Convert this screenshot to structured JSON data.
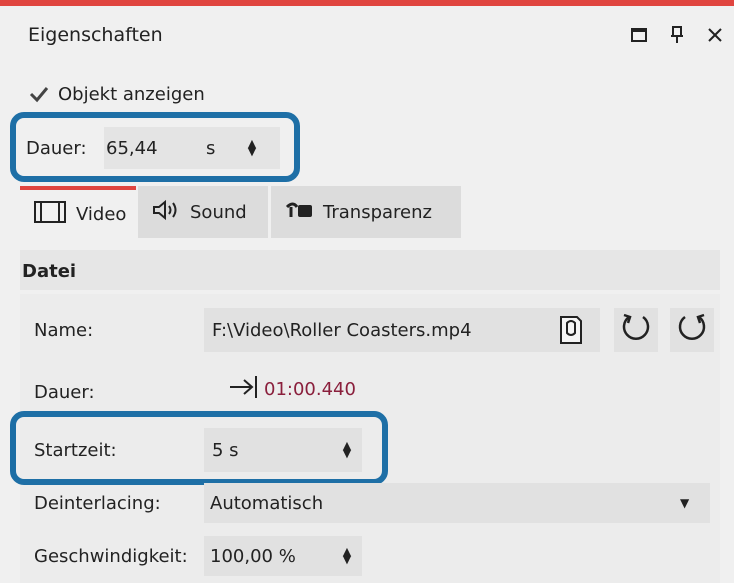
{
  "panel": {
    "title": "Eigenschaften",
    "window_icons": [
      "restore-icon",
      "pin-icon",
      "close-icon"
    ]
  },
  "show_object": {
    "label": "Objekt anzeigen",
    "checked": true
  },
  "duration": {
    "label": "Dauer:",
    "value": "65,44",
    "unit": "s"
  },
  "tabs": [
    {
      "label": "Video",
      "icon": "film-icon",
      "active": true
    },
    {
      "label": "Sound",
      "icon": "speaker-icon",
      "active": false
    },
    {
      "label": "Transparenz",
      "icon": "transparency-icon",
      "active": false
    }
  ],
  "section": {
    "label": "Datei"
  },
  "file": {
    "name_label": "Name:",
    "name_value": "F:\\Video\\Roller Coasters.mp4",
    "duration_label": "Dauer:",
    "duration_value": "01:00.440",
    "start_label": "Startzeit:",
    "start_value": "5 s",
    "deinterlacing_label": "Deinterlacing:",
    "deinterlacing_value": "Automatisch",
    "speed_label": "Geschwindigkeit:",
    "speed_value": "100,00 %"
  },
  "colors": {
    "accent_red": "#e0453f",
    "highlight_blue": "#1e6fa6",
    "duration_text": "#8a1f3c"
  }
}
